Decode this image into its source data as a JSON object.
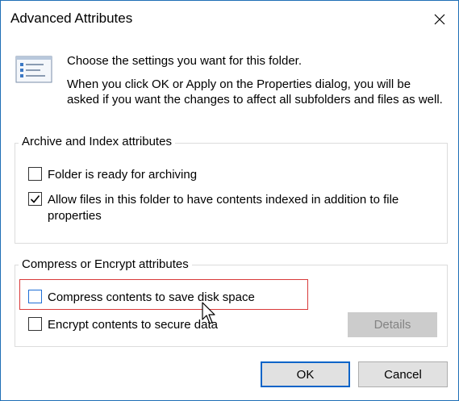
{
  "window": {
    "title": "Advanced Attributes",
    "close_icon": "close-icon"
  },
  "intro": {
    "icon": "attributes-list-icon",
    "line1": "Choose the settings you want for this folder.",
    "line2": "When you click OK or Apply on the Properties dialog, you will be asked if you want the changes to affect all subfolders and files as well."
  },
  "archive_group": {
    "label": "Archive and Index attributes",
    "items": [
      {
        "label": "Folder is ready for archiving",
        "checked": false
      },
      {
        "label": "Allow files in this folder to have contents indexed in addition to file properties",
        "checked": true
      }
    ]
  },
  "compress_group": {
    "label": "Compress or Encrypt attributes",
    "items": [
      {
        "label": "Compress contents to save disk space",
        "checked": false
      },
      {
        "label": "Encrypt contents to secure data",
        "checked": false
      }
    ],
    "details_label": "Details"
  },
  "buttons": {
    "ok_label": "OK",
    "cancel_label": "Cancel"
  },
  "colors": {
    "accent": "#0a64c8",
    "highlight": "#d93a3a"
  }
}
